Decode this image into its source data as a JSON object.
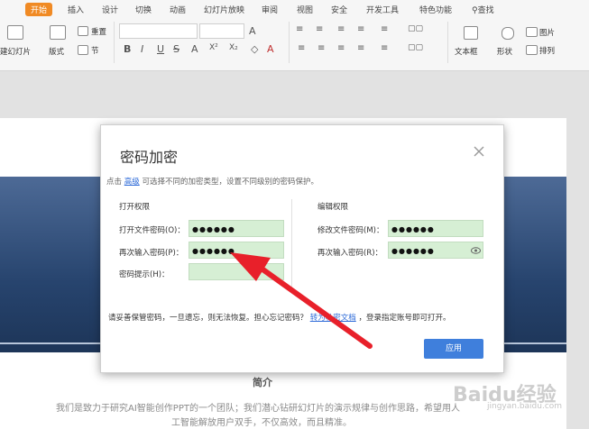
{
  "ribbon": {
    "tabs": [
      "开始",
      "插入",
      "设计",
      "切换",
      "动画",
      "幻灯片放映",
      "审阅",
      "视图",
      "安全",
      "开发工具",
      "特色功能"
    ],
    "search_label": "查找",
    "new_slide": "建幻灯片",
    "layout": "版式",
    "reset": "重置",
    "section": "节",
    "textbox": "文本框",
    "shape": "形状",
    "picture": "图片",
    "arrange": "排列",
    "format_buttons": [
      "B",
      "I",
      "U",
      "S",
      "A",
      "X²",
      "X₂",
      "A",
      "A"
    ]
  },
  "dialog": {
    "title": "密码加密",
    "desc_prefix": "点击",
    "desc_link": "高级",
    "desc_suffix": "可选择不同的加密类型，设置不同级别的密码保护。",
    "open_section": "打开权限",
    "edit_section": "编辑权限",
    "open_pw_label": "打开文件密码(O)：",
    "open_pw_value": "●●●●●●",
    "open_confirm_label": "再次输入密码(P)：",
    "open_confirm_value": "●●●●●●",
    "hint_label": "密码提示(H)：",
    "hint_value": "",
    "edit_pw_label": "修改文件密码(M)：",
    "edit_pw_value": "●●●●●●",
    "edit_confirm_label": "再次输入密码(R)：",
    "edit_confirm_value": "●●●●●●",
    "notice_prefix": "请妥善保管密码，一旦遗忘，则无法恢复。担心忘记密码？",
    "notice_link": "转为私密文档",
    "notice_suffix": "，登录指定账号即可打开。",
    "ok": "应用"
  },
  "slide": {
    "intro_title": "简介",
    "intro_line1": "我们是致力于研究AI智能创作PPT的一个团队；我们潜心钻研幻灯片的演示规律与创作思路，希望用人",
    "intro_line2": "工智能解放用户双手，不仅高效，而且精准。"
  },
  "watermark": {
    "text": "Baidu经验",
    "sub": "jingyan.baidu.com"
  },
  "colors": {
    "accent": "#f08a24",
    "button": "#3f7fdc",
    "field": "#d6efd4",
    "arrow": "#e8202a"
  }
}
